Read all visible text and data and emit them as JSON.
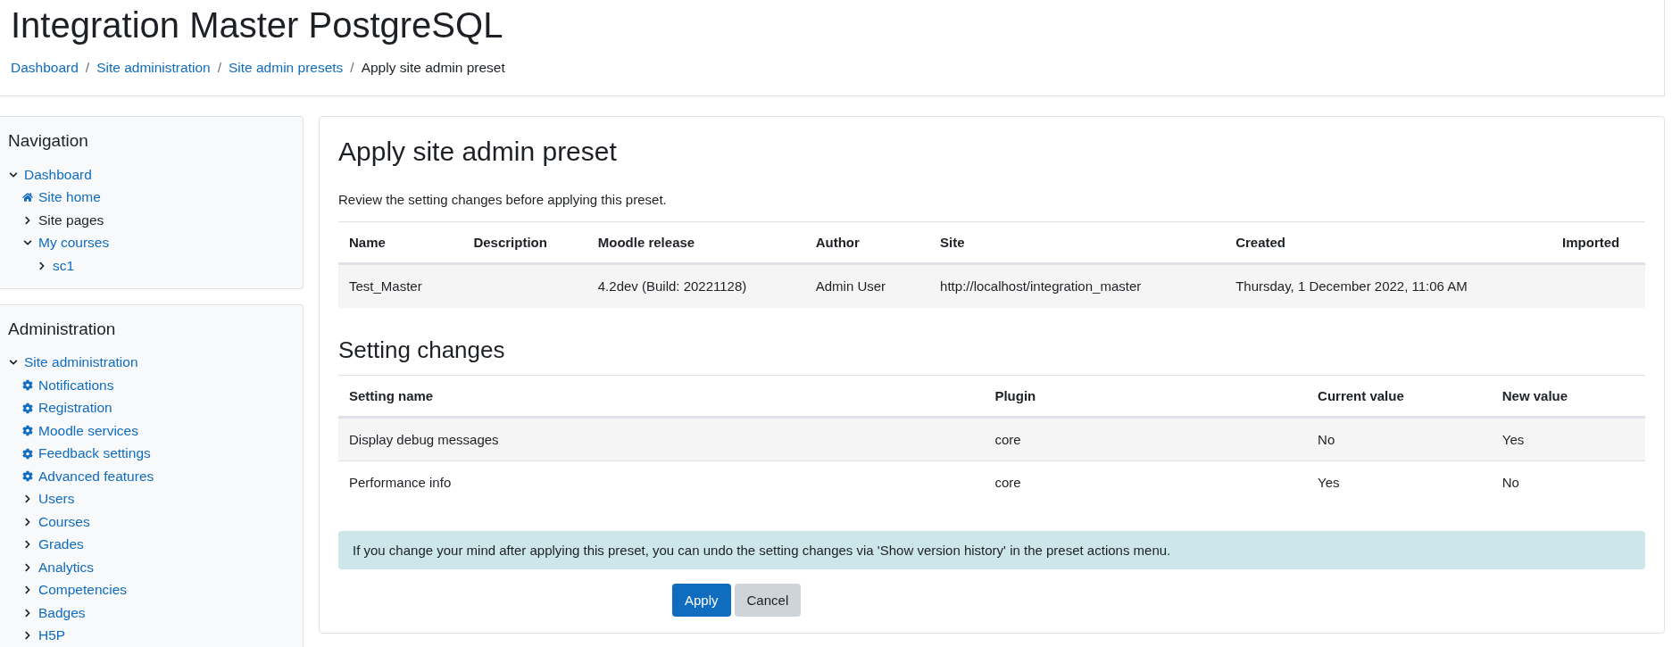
{
  "site_title": "Integration Master PostgreSQL",
  "breadcrumb": [
    {
      "label": "Dashboard",
      "link": true
    },
    {
      "label": "Site administration",
      "link": true
    },
    {
      "label": "Site admin presets",
      "link": true
    },
    {
      "label": "Apply site admin preset",
      "link": false
    }
  ],
  "separator": "/",
  "blocks": [
    {
      "title": "Navigation",
      "items": [
        {
          "kind": "branch",
          "label": "Dashboard",
          "link": true,
          "expanded": true,
          "children": [
            {
              "kind": "home",
              "label": "Site home",
              "link": true
            },
            {
              "kind": "branch",
              "label": "Site pages",
              "link": false,
              "expanded": false
            },
            {
              "kind": "branch",
              "label": "My courses",
              "link": true,
              "expanded": true,
              "children": [
                {
                  "kind": "branch",
                  "label": "sc1",
                  "link": true,
                  "expanded": false
                }
              ]
            }
          ]
        }
      ]
    },
    {
      "title": "Administration",
      "items": [
        {
          "kind": "branch",
          "label": "Site administration",
          "link": true,
          "expanded": true,
          "children": [
            {
              "kind": "setting",
              "label": "Notifications",
              "link": true
            },
            {
              "kind": "setting",
              "label": "Registration",
              "link": true
            },
            {
              "kind": "setting",
              "label": "Moodle services",
              "link": true
            },
            {
              "kind": "setting",
              "label": "Feedback settings",
              "link": true
            },
            {
              "kind": "setting",
              "label": "Advanced features",
              "link": true
            },
            {
              "kind": "branch",
              "label": "Users",
              "link": true,
              "expanded": false
            },
            {
              "kind": "branch",
              "label": "Courses",
              "link": true,
              "expanded": false
            },
            {
              "kind": "branch",
              "label": "Grades",
              "link": true,
              "expanded": false
            },
            {
              "kind": "branch",
              "label": "Analytics",
              "link": true,
              "expanded": false
            },
            {
              "kind": "branch",
              "label": "Competencies",
              "link": true,
              "expanded": false
            },
            {
              "kind": "branch",
              "label": "Badges",
              "link": true,
              "expanded": false
            },
            {
              "kind": "branch",
              "label": "H5P",
              "link": true,
              "expanded": false
            }
          ]
        }
      ]
    }
  ],
  "main": {
    "heading": "Apply site admin preset",
    "intro": "Review the setting changes before applying this preset.",
    "preset_table": {
      "columns": [
        "Name",
        "Description",
        "Moodle release",
        "Author",
        "Site",
        "Created",
        "Imported"
      ],
      "rows": [
        [
          "Test_Master",
          "",
          "4.2dev (Build: 20221128)",
          "Admin User",
          "http://localhost/integration_master",
          "Thursday, 1 December 2022, 11:06 AM",
          ""
        ]
      ]
    },
    "changes_heading": "Setting changes",
    "changes_table": {
      "columns": [
        "Setting name",
        "Plugin",
        "Current value",
        "New value"
      ],
      "rows": [
        [
          "Display debug messages",
          "core",
          "No",
          "Yes"
        ],
        [
          "Performance info",
          "core",
          "Yes",
          "No"
        ]
      ]
    },
    "notice": "If you change your mind after applying this preset, you can undo the setting changes via 'Show version history' in the preset actions menu.",
    "buttons": [
      {
        "label": "Apply",
        "kind": "primary"
      },
      {
        "label": "Cancel",
        "kind": "secondary"
      }
    ]
  }
}
